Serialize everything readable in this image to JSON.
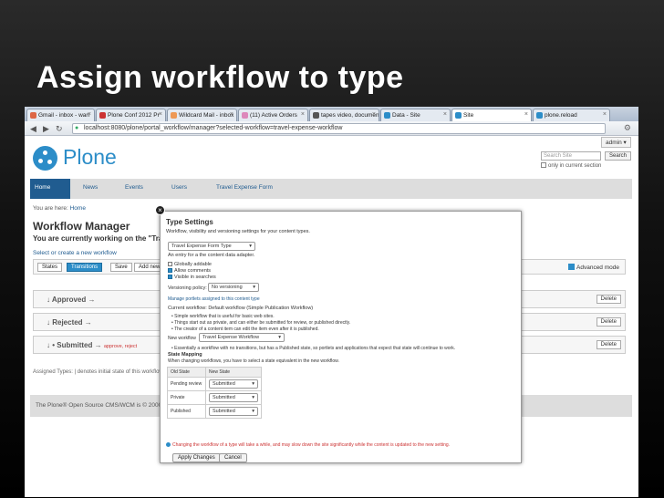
{
  "slide": {
    "title": "Assign workflow to type"
  },
  "browser": {
    "tabs": [
      {
        "label": "Gmail - inbox - wan"
      },
      {
        "label": "Plone Conf 2012 Pr"
      },
      {
        "label": "Wildcard Mail - inbox"
      },
      {
        "label": "(11) Active Orders"
      },
      {
        "label": "tapes video, documen"
      },
      {
        "label": "Data - Site"
      },
      {
        "label": "Site"
      },
      {
        "label": "plone.reload"
      }
    ],
    "url": "localhost:8080/plone/portal_workflow/manager?selected-workflow=travel-expense-workflow"
  },
  "plone": {
    "logo_text": "Plone",
    "admin_label": "admin ▾",
    "search_placeholder": "Search Site",
    "search_button": "Search",
    "search_only": "only in current section",
    "nav": [
      "Home",
      "News",
      "Events",
      "Users",
      "Travel Expense Form"
    ],
    "breadcrumb_prefix": "You are here:",
    "breadcrumb_home": "Home",
    "page_title": "Workflow Manager",
    "subtitle": "You are currently working on the \"Tra",
    "select_link": "Select or create a new workflow",
    "toolbar": {
      "states": "States",
      "transitions": "Transitions",
      "save": "Save",
      "add": "Add new"
    },
    "advanced_mode": "Advanced mode",
    "states": [
      {
        "label": "↓  Approved →",
        "extra": "",
        "delete": "Delete"
      },
      {
        "label": "↓  Rejected →",
        "extra": "",
        "delete": "Delete"
      },
      {
        "label": "↓  • Submitted →",
        "extra": "approve,  reject",
        "delete": "Delete"
      }
    ],
    "assigned_types": "Assigned Types: | denotes initial state of this workflow",
    "footer": "The Plone® Open Source CMS/WCM is © 2000-20"
  },
  "modal": {
    "close": "×",
    "title": "Type Settings",
    "subtitle": "Workflow, visibility and versioning settings for your content types.",
    "type_select": "Travel Expense Form Type",
    "entry_hint": "An entry for a the content data adapter.",
    "checks": [
      {
        "label": "Globally addable",
        "checked": false
      },
      {
        "label": "Allow comments",
        "checked": true
      },
      {
        "label": "Visible in searches",
        "checked": true
      }
    ],
    "versioning_label": "Versioning policy:",
    "versioning_value": "No versioning",
    "manage_link": "Manage portlets assigned to this content type",
    "current_workflow": "Current workflow: Default workflow (Simple Publication Workflow)",
    "bullets": [
      "Simple workflow that is useful for basic web sites.",
      "Things start out as private, and can either be submitted for review, or published directly.",
      "The creator of a content item can edit the item even after it is published."
    ],
    "new_workflow_label": "New workflow",
    "new_workflow_value": "Travel Expense Workflow",
    "new_workflow_desc": "Essentially a workflow with no transitions, but has a Published state, so portlets and applications that expect that state will continue to work.",
    "state_mapping_title": "State Mapping",
    "state_mapping_desc": "When changing workflows, you have to select a state equivalent in the new workflow.",
    "mapping_headers": [
      "Old State",
      "New State"
    ],
    "mapping_rows": [
      {
        "old": "Pending review",
        "new": "Submitted"
      },
      {
        "old": "Private",
        "new": "Submitted"
      },
      {
        "old": "Published",
        "new": "Submitted"
      }
    ],
    "warning": "Changing the workflow of a type will take a while, and may slow down the site significantly while the content is updated to the new setting.",
    "apply": "Apply Changes",
    "cancel": "Cancel"
  }
}
